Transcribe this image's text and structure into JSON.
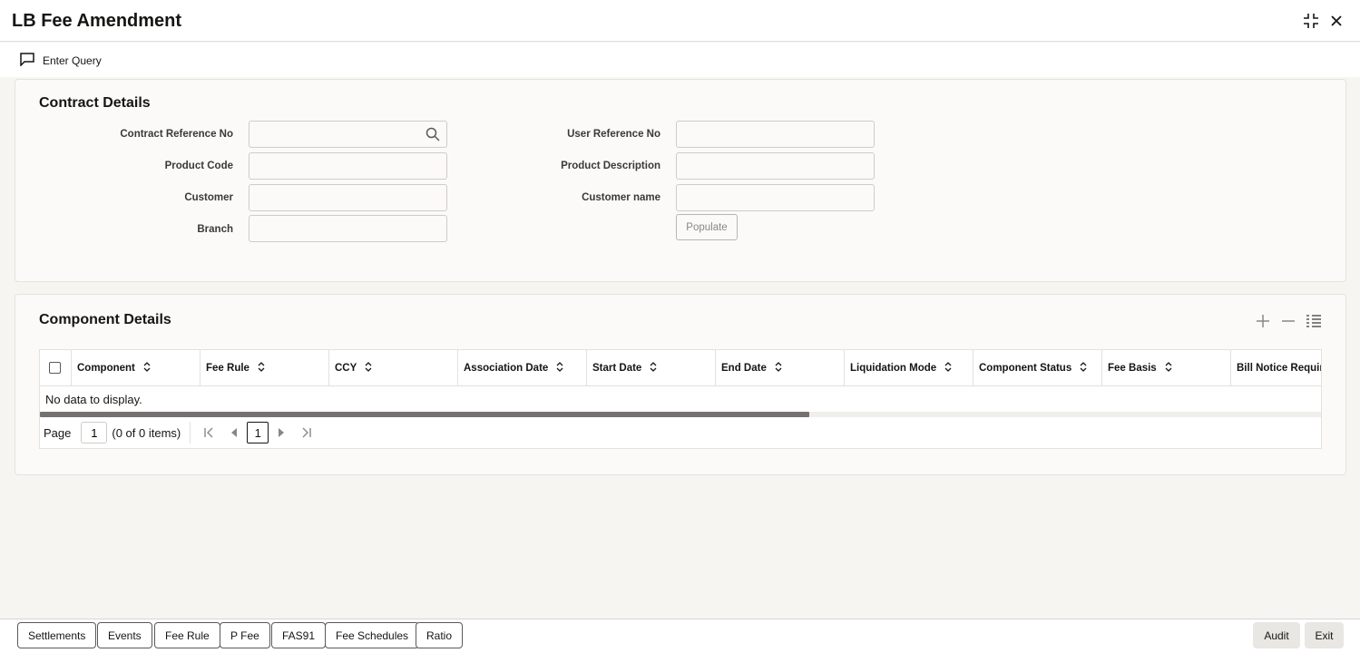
{
  "window": {
    "title": "LB Fee Amendment",
    "maximize_icon": "collapse-arrows-icon",
    "close_icon": "close-icon"
  },
  "toolbar": {
    "enter_query_label": "Enter Query",
    "enter_query_icon": "chat-bubble-icon"
  },
  "contract_details": {
    "title": "Contract Details",
    "contract_reference_no": {
      "label": "Contract Reference No",
      "value": ""
    },
    "product_code": {
      "label": "Product Code",
      "value": ""
    },
    "customer": {
      "label": "Customer",
      "value": ""
    },
    "branch": {
      "label": "Branch",
      "value": ""
    },
    "user_reference_no": {
      "label": "User Reference No",
      "value": ""
    },
    "product_description": {
      "label": "Product Description",
      "value": ""
    },
    "customer_name": {
      "label": "Customer name",
      "value": ""
    },
    "populate_label": "Populate"
  },
  "component_details": {
    "title": "Component Details",
    "columns": [
      "Component",
      "Fee Rule",
      "CCY",
      "Association Date",
      "Start Date",
      "End Date",
      "Liquidation Mode",
      "Component Status",
      "Fee Basis",
      "Bill Notice Required"
    ],
    "rows": [],
    "empty_text": "No data to display.",
    "pagination": {
      "page_label": "Page",
      "page_value": "1",
      "items_text": "(0 of 0 items)",
      "current_page": "1"
    }
  },
  "footer": {
    "buttons": [
      "Settlements",
      "Events",
      "Fee Rule",
      "P Fee",
      "FAS91",
      "Fee Schedules",
      "Ratio"
    ],
    "audit_label": "Audit",
    "exit_label": "Exit"
  },
  "colors": {
    "background": "#f6f5f2",
    "panel": "#fbfaf8",
    "text": "#161513",
    "border": "#e4e1dc"
  }
}
